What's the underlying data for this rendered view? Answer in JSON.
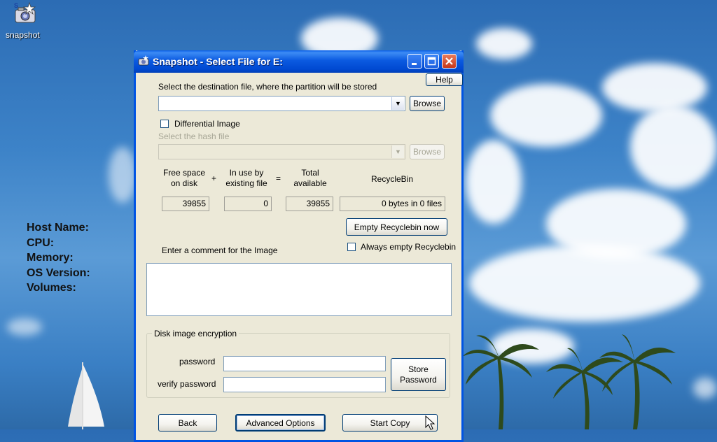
{
  "desktop": {
    "icon_label": "snapshot",
    "sysinfo": [
      "Host Name:",
      "CPU:",
      "Memory:",
      "OS Version:",
      "Volumes:"
    ]
  },
  "window": {
    "title": "Snapshot - Select File for E:",
    "help": "Help",
    "dest_label": "Select the destination file, where the partition will be stored",
    "dest_value": "",
    "browse": "Browse",
    "differential_label": "Differential Image",
    "hash_label": "Select the hash file",
    "browse2": "Browse",
    "free_space": "Free space\non disk",
    "plus": "+",
    "in_use": "In use by\nexisting file",
    "equals": "=",
    "total": "Total\navailable",
    "recyclebin": "RecycleBin",
    "free_value": "39855",
    "inuse_value": "0",
    "total_value": "39855",
    "recycle_value": "0 bytes in 0 files",
    "empty_recycle": "Empty Recyclebin now",
    "always_empty": "Always empty Recyclebin",
    "comment_label": "Enter a comment for the Image",
    "encryption_title": "Disk image encryption",
    "password_label": "password",
    "verify_label": "verify password",
    "store_password": "Store\nPassword",
    "back": "Back",
    "advanced": "Advanced Options",
    "start_copy": "Start Copy"
  }
}
